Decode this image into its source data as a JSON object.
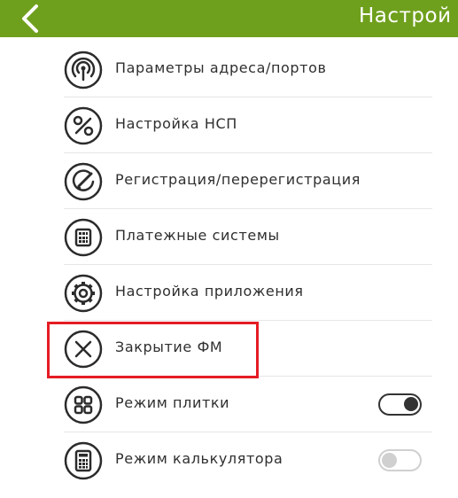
{
  "header": {
    "title": "Настрой",
    "back_icon": "chevron-left-icon",
    "background_color": "#6fa01d"
  },
  "items": [
    {
      "label": "Параметры адреса/портов",
      "icon": "antenna-icon"
    },
    {
      "label": "Настройка НСП",
      "icon": "percent-icon"
    },
    {
      "label": "Регистрация/перерегистрация",
      "icon": "pencil-circle-icon"
    },
    {
      "label": "Платежные системы",
      "icon": "calculator-grid-icon"
    },
    {
      "label": "Настройка приложения",
      "icon": "gear-icon"
    },
    {
      "label": "Закрытие ФМ",
      "icon": "close-circle-icon"
    },
    {
      "label": "Режим плитки",
      "icon": "tiles-icon",
      "toggle": true
    },
    {
      "label": "Режим калькулятора",
      "icon": "calculator-icon",
      "toggle": false
    }
  ],
  "highlight_color": "#e51c23"
}
